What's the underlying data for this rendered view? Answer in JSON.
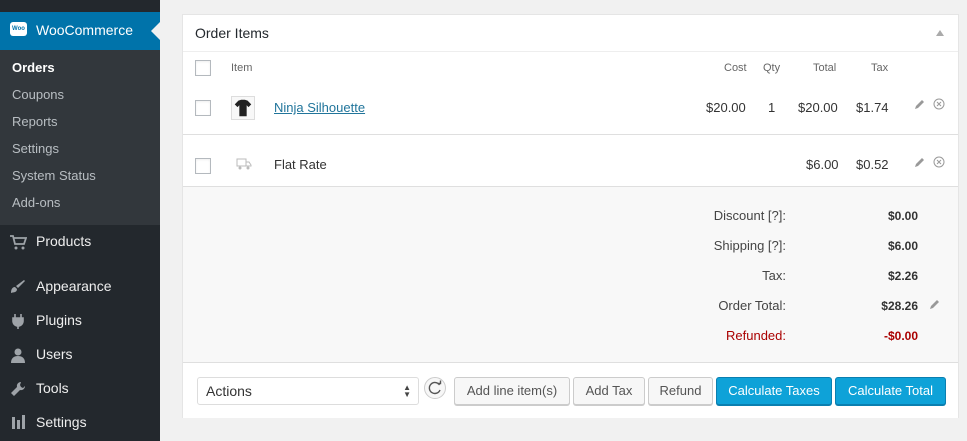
{
  "sidebar": {
    "woocommerce_label": "WooCommerce",
    "logo_text": "Woo",
    "submenu": [
      "Orders",
      "Coupons",
      "Reports",
      "Settings",
      "System Status",
      "Add-ons"
    ],
    "menu": [
      "Products",
      "Appearance",
      "Plugins",
      "Users",
      "Tools",
      "Settings"
    ]
  },
  "panel": {
    "title": "Order Items",
    "headers": {
      "item": "Item",
      "cost": "Cost",
      "qty": "Qty",
      "total": "Total",
      "tax": "Tax"
    }
  },
  "items": [
    {
      "name": "Ninja Silhouette",
      "cost": "$20.00",
      "qty": "1",
      "total": "$20.00",
      "tax": "$1.74"
    }
  ],
  "shipping": {
    "name": "Flat Rate",
    "total": "$6.00",
    "tax": "$0.52"
  },
  "totals": {
    "discount_label": "Discount [?]:",
    "discount": "$0.00",
    "shipping_label": "Shipping [?]:",
    "shipping": "$6.00",
    "tax_label": "Tax:",
    "tax": "$2.26",
    "order_total_label": "Order Total:",
    "order_total": "$28.26",
    "refunded_label": "Refunded:",
    "refunded": "-$0.00"
  },
  "actions": {
    "select_value": "Actions",
    "add_line_item": "Add line item(s)",
    "add_tax": "Add Tax",
    "refund": "Refund",
    "calculate_taxes": "Calculate Taxes",
    "calculate_total": "Calculate Total"
  },
  "colors": {
    "admin_bar": "#23282d",
    "accent": "#0073aa",
    "button_primary": "#0ea2d8",
    "refund_red": "#a00"
  }
}
